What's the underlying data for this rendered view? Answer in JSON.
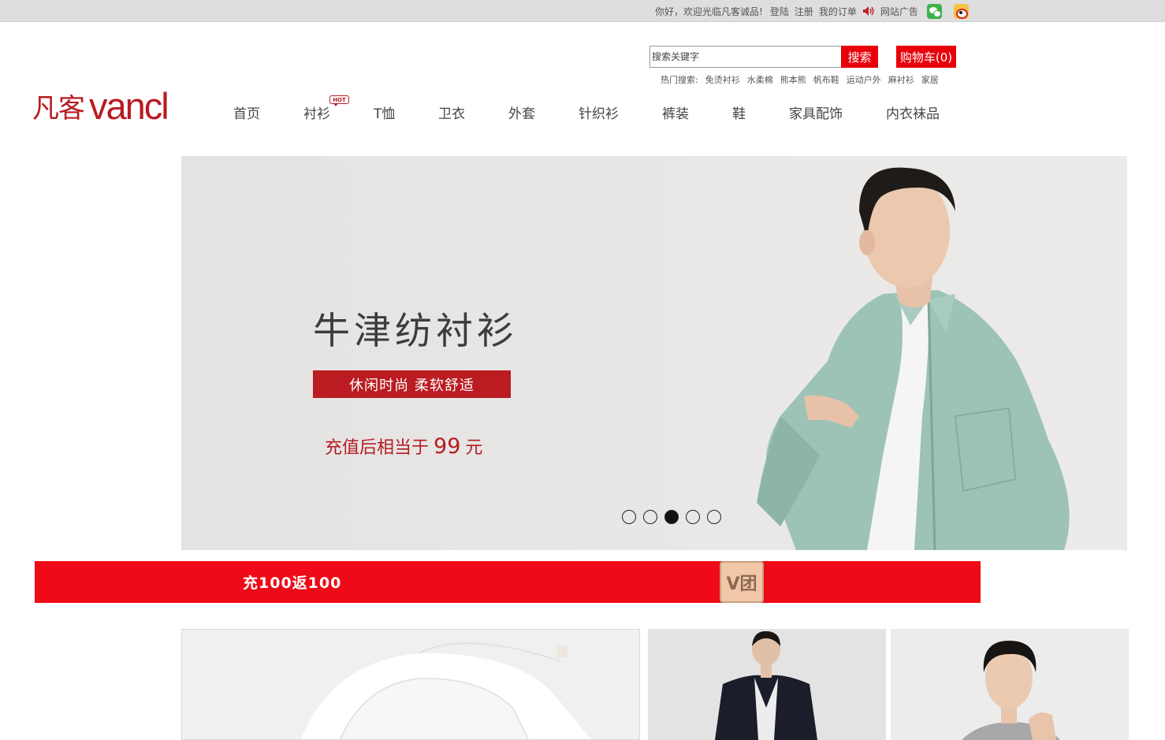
{
  "topbar": {
    "welcome": "你好，欢迎光临凡客诚品!",
    "login": "登陆",
    "register": "注册",
    "my_orders": "我的订单",
    "site_ads": "网站广告",
    "icons": [
      "speaker-icon",
      "wechat-icon",
      "weibo-icon"
    ]
  },
  "logo": {
    "cn": "凡客",
    "en": "vancl"
  },
  "search": {
    "placeholder": "搜索关键字",
    "button": "搜索",
    "hot_label": "热门搜索:",
    "hot_terms": [
      "免烫衬衫",
      "水柔棉",
      "熊本熊",
      "帆布鞋",
      "运动户外",
      "麻衬衫",
      "家居"
    ]
  },
  "cart": {
    "label": "购物车(0)"
  },
  "nav": {
    "items": [
      "首页",
      "衬衫",
      "T恤",
      "卫衣",
      "外套",
      "针织衫",
      "裤装",
      "鞋",
      "家具配饰",
      "内衣袜品"
    ],
    "hot_badge": "HOT"
  },
  "banner": {
    "headline": "牛津纺衬衫",
    "tagline": "休闲时尚 柔软舒适",
    "price_prefix": "充值后相当于",
    "price_value": "99",
    "price_unit": "元",
    "slide_count": 5,
    "active_slide": 3
  },
  "promo": {
    "text": "充100返100",
    "badge": "V团"
  },
  "colors": {
    "brand_red": "#b71c22",
    "accent_red": "#e8000b",
    "promo_red": "#ef0a17",
    "topbar_bg": "#dedede"
  }
}
